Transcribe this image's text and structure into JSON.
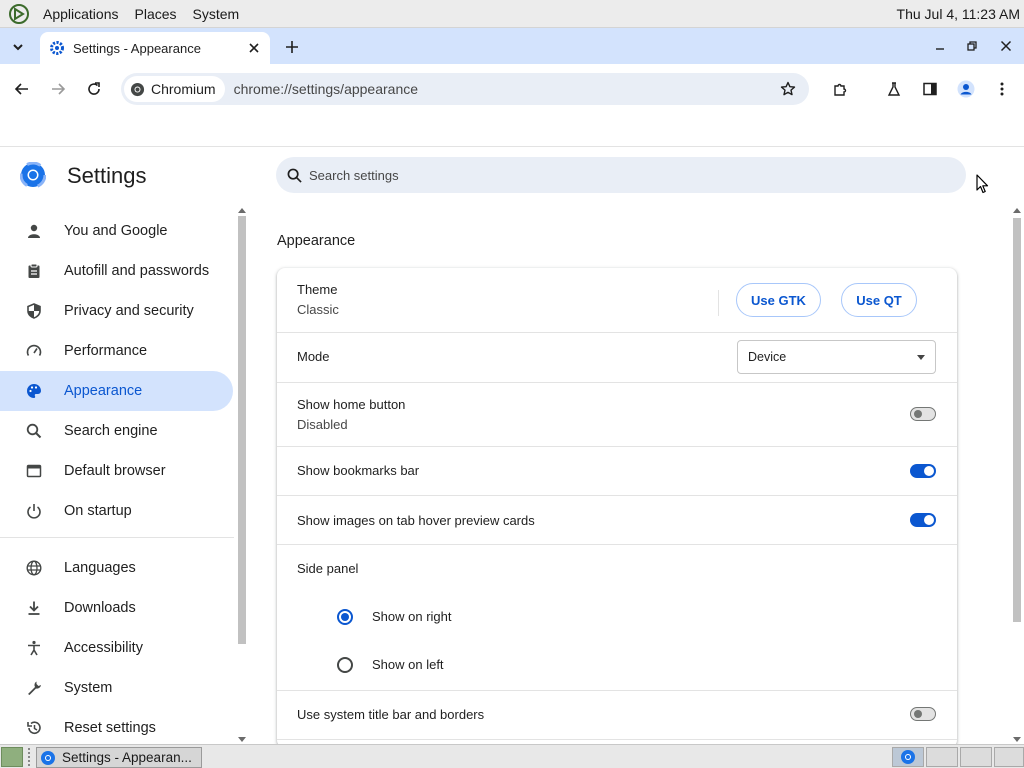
{
  "os_panel": {
    "menus": [
      "Applications",
      "Places",
      "System"
    ],
    "clock": "Thu Jul  4, 11:23 AM"
  },
  "browser": {
    "tab_title": "Settings - Appearance",
    "chip_label": "Chromium",
    "url": "chrome://settings/appearance"
  },
  "settings": {
    "title": "Settings",
    "search_placeholder": "Search settings",
    "nav": [
      {
        "label": "You and Google",
        "icon": "person-icon"
      },
      {
        "label": "Autofill and passwords",
        "icon": "clipboard-icon"
      },
      {
        "label": "Privacy and security",
        "icon": "shield-icon"
      },
      {
        "label": "Performance",
        "icon": "speedometer-icon"
      },
      {
        "label": "Appearance",
        "icon": "palette-icon",
        "active": true
      },
      {
        "label": "Search engine",
        "icon": "search-icon"
      },
      {
        "label": "Default browser",
        "icon": "browser-window-icon"
      },
      {
        "label": "On startup",
        "icon": "power-icon"
      },
      {
        "label": "Languages",
        "icon": "globe-icon"
      },
      {
        "label": "Downloads",
        "icon": "download-icon"
      },
      {
        "label": "Accessibility",
        "icon": "accessibility-icon"
      },
      {
        "label": "System",
        "icon": "wrench-icon"
      },
      {
        "label": "Reset settings",
        "icon": "reset-icon"
      }
    ]
  },
  "appearance": {
    "section_title": "Appearance",
    "theme": {
      "label": "Theme",
      "value": "Classic",
      "gtk_button": "Use GTK",
      "qt_button": "Use QT"
    },
    "mode": {
      "label": "Mode",
      "selected": "Device"
    },
    "home_button": {
      "label": "Show home button",
      "sub": "Disabled",
      "enabled": false
    },
    "bookmarks_bar": {
      "label": "Show bookmarks bar",
      "enabled": true
    },
    "hover_cards": {
      "label": "Show images on tab hover preview cards",
      "enabled": true
    },
    "side_panel": {
      "label": "Side panel",
      "options": [
        "Show on right",
        "Show on left"
      ],
      "selected": "Show on right"
    },
    "title_bar": {
      "label": "Use system title bar and borders",
      "enabled": false
    }
  },
  "taskbar": {
    "task_label": "Settings - Appearan..."
  },
  "colors": {
    "accent": "#0b57d0",
    "active_nav_bg": "#d3e3fd",
    "tabstrip": "#d3e3fd"
  }
}
